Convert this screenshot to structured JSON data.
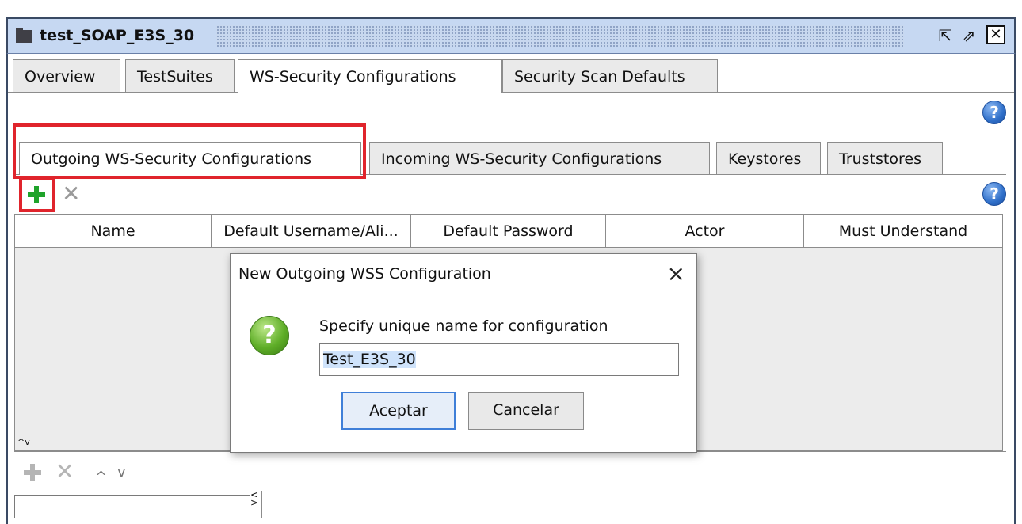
{
  "window": {
    "title": "test_SOAP_E3S_30",
    "restore_glyph": "⇱",
    "maximize_glyph": "⇗",
    "close_glyph": "✕"
  },
  "top_tabs": [
    "Overview",
    "TestSuites",
    "WS-Security Configurations",
    "Security Scan Defaults"
  ],
  "active_top_tab": "WS-Security Configurations",
  "sub_tabs": [
    "Outgoing WS-Security Configurations",
    "Incoming WS-Security Configurations",
    "Keystores",
    "Truststores"
  ],
  "active_sub_tab": "Outgoing WS-Security Configurations",
  "toolbar": {
    "add_icon": "plus-icon",
    "remove_icon": "x-icon",
    "help_glyph": "?"
  },
  "table": {
    "columns": [
      "Name",
      "Default Username/Ali...",
      "Default Password",
      "Actor",
      "Must Understand"
    ]
  },
  "bottom_toolbar": {
    "up_glyph": "^",
    "down_glyph": "v",
    "splitter_glyph": "^v"
  },
  "dialog": {
    "title": "New Outgoing WSS Configuration",
    "close_glyph": "×",
    "message": "Specify unique name for configuration",
    "input_value": "Test_E3S_30",
    "ok_label": "Aceptar",
    "cancel_label": "Cancelar",
    "question_glyph": "?"
  },
  "colors": {
    "highlight": "#e0242c",
    "add_green": "#1fa32a",
    "disabled_gray": "#9a9a9a",
    "titlebar": "#c6d8f2"
  }
}
